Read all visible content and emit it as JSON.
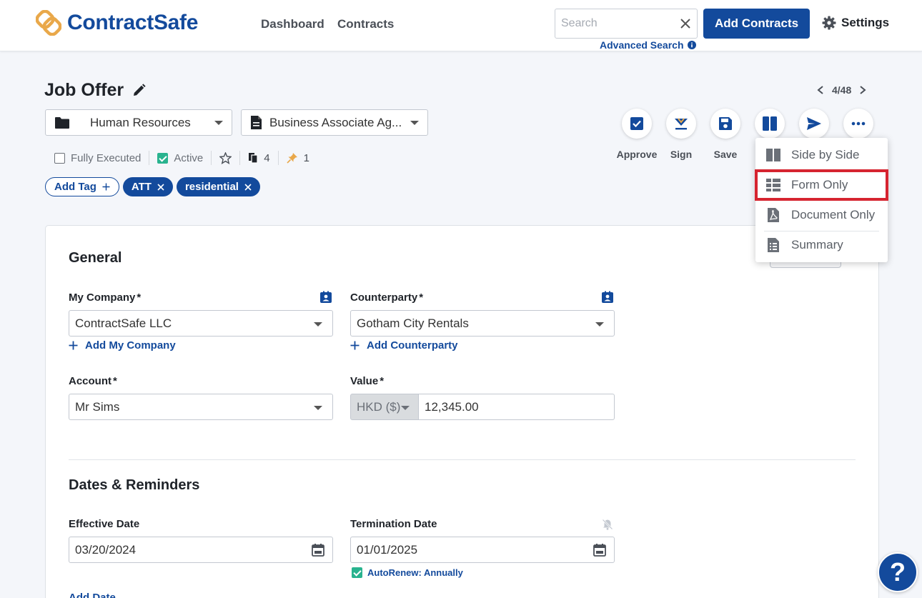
{
  "header": {
    "brand": "ContractSafe",
    "nav": [
      "Dashboard",
      "Contracts"
    ],
    "search_placeholder": "Search",
    "advanced_search": "Advanced Search",
    "add_contracts": "Add Contracts",
    "settings": "Settings"
  },
  "contract": {
    "title": "Job Offer",
    "pager": "4/48",
    "folder": "Human Resources",
    "type": "Business Associate Ag...",
    "fully_executed": "Fully Executed",
    "active": "Active",
    "file_count": "4",
    "pin_count": "1",
    "add_tag": "Add Tag",
    "tags": [
      "ATT",
      "residential"
    ]
  },
  "actions": {
    "approve": "Approve",
    "sign": "Sign",
    "save": "Save"
  },
  "view_menu": {
    "items": [
      "Side by Side",
      "Form Only",
      "Document Only",
      "Summary"
    ]
  },
  "general": {
    "title": "General",
    "my_company_label": "My Company",
    "my_company_value": "ContractSafe LLC",
    "add_my_company": "Add My Company",
    "counterparty_label": "Counterparty",
    "counterparty_value": "Gotham City Rentals",
    "add_counterparty": "Add Counterparty",
    "account_label": "Account",
    "account_value": "Mr Sims",
    "value_label": "Value",
    "currency": "HKD ($)",
    "amount": "12,345.00",
    "required_mark": "*"
  },
  "dates": {
    "title": "Dates & Reminders",
    "effective_label": "Effective Date",
    "effective_value": "03/20/2024",
    "termination_label": "Termination Date",
    "termination_value": "01/01/2025",
    "autorenew": "AutoRenew: Annually",
    "add_date": "Add Date"
  },
  "help": "?",
  "colors": {
    "brand_blue": "#134a9c",
    "logo_orange": "#e9a84a",
    "check_green": "#29b38f",
    "highlight_red": "#d62430"
  }
}
